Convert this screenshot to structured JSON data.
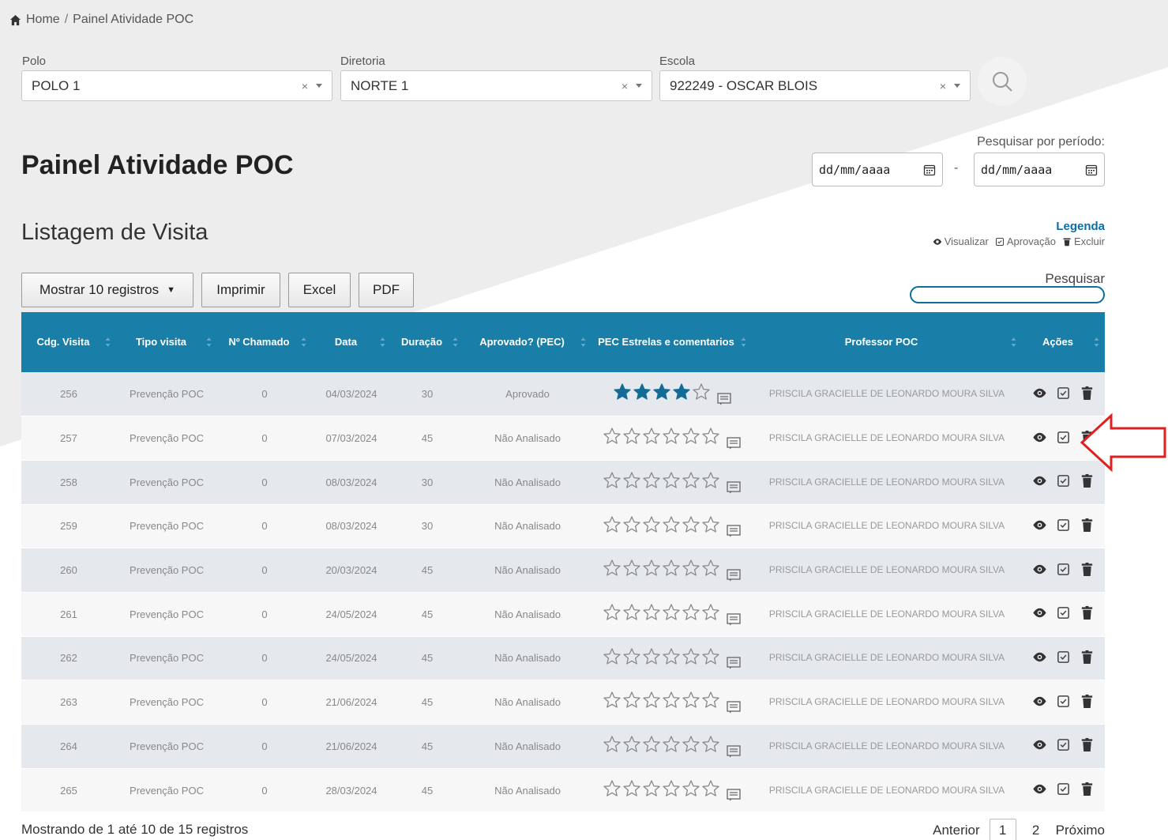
{
  "breadcrumb": {
    "home": "Home",
    "current": "Painel Atividade POC"
  },
  "filters": {
    "polo": {
      "label": "Polo",
      "value": "POLO 1"
    },
    "diretoria": {
      "label": "Diretoria",
      "value": "NORTE 1"
    },
    "escola": {
      "label": "Escola",
      "value": "922249 - OSCAR BLOIS"
    },
    "clear_symbol": "×"
  },
  "page_title": "Painel Atividade POC",
  "period": {
    "label": "Pesquisar por período:",
    "start_placeholder": "dd/mm/aaaa",
    "end_placeholder": "dd/mm/aaaa",
    "separator": "-"
  },
  "section_title": "Listagem de Visita",
  "legend": {
    "title": "Legenda",
    "view": "Visualizar",
    "approve": "Aprovação",
    "delete": "Excluir"
  },
  "toolbar": {
    "show_records": "Mostrar 10 registros",
    "print": "Imprimir",
    "excel": "Excel",
    "pdf": "PDF",
    "search_label": "Pesquisar"
  },
  "table": {
    "headers": {
      "code": "Cdg. Visita",
      "type": "Tipo visita",
      "ticket": "Nº Chamado",
      "date": "Data",
      "duration": "Duração",
      "approved": "Aprovado? (PEC)",
      "pec": "PEC Estrelas e comentarios",
      "teacher": "Professor POC",
      "actions": "Ações"
    },
    "rows": [
      {
        "code": "256",
        "type": "Prevenção POC",
        "ticket": "0",
        "date": "04/03/2024",
        "duration": "30",
        "approved": "Aprovado",
        "stars": 4,
        "teacher": "PRISCILA GRACIELLE DE LEONARDO MOURA SILVA"
      },
      {
        "code": "257",
        "type": "Prevenção POC",
        "ticket": "0",
        "date": "07/03/2024",
        "duration": "45",
        "approved": "Não Analisado",
        "stars": 0,
        "teacher": "PRISCILA GRACIELLE DE LEONARDO MOURA SILVA"
      },
      {
        "code": "258",
        "type": "Prevenção POC",
        "ticket": "0",
        "date": "08/03/2024",
        "duration": "30",
        "approved": "Não Analisado",
        "stars": 0,
        "teacher": "PRISCILA GRACIELLE DE LEONARDO MOURA SILVA"
      },
      {
        "code": "259",
        "type": "Prevenção POC",
        "ticket": "0",
        "date": "08/03/2024",
        "duration": "30",
        "approved": "Não Analisado",
        "stars": 0,
        "teacher": "PRISCILA GRACIELLE DE LEONARDO MOURA SILVA"
      },
      {
        "code": "260",
        "type": "Prevenção POC",
        "ticket": "0",
        "date": "20/03/2024",
        "duration": "45",
        "approved": "Não Analisado",
        "stars": 0,
        "teacher": "PRISCILA GRACIELLE DE LEONARDO MOURA SILVA"
      },
      {
        "code": "261",
        "type": "Prevenção POC",
        "ticket": "0",
        "date": "24/05/2024",
        "duration": "45",
        "approved": "Não Analisado",
        "stars": 0,
        "teacher": "PRISCILA GRACIELLE DE LEONARDO MOURA SILVA"
      },
      {
        "code": "262",
        "type": "Prevenção POC",
        "ticket": "0",
        "date": "24/05/2024",
        "duration": "45",
        "approved": "Não Analisado",
        "stars": 0,
        "teacher": "PRISCILA GRACIELLE DE LEONARDO MOURA SILVA"
      },
      {
        "code": "263",
        "type": "Prevenção POC",
        "ticket": "0",
        "date": "21/06/2024",
        "duration": "45",
        "approved": "Não Analisado",
        "stars": 0,
        "teacher": "PRISCILA GRACIELLE DE LEONARDO MOURA SILVA"
      },
      {
        "code": "264",
        "type": "Prevenção POC",
        "ticket": "0",
        "date": "21/06/2024",
        "duration": "45",
        "approved": "Não Analisado",
        "stars": 0,
        "teacher": "PRISCILA GRACIELLE DE LEONARDO MOURA SILVA"
      },
      {
        "code": "265",
        "type": "Prevenção POC",
        "ticket": "0",
        "date": "28/03/2024",
        "duration": "45",
        "approved": "Não Analisado",
        "stars": 0,
        "teacher": "PRISCILA GRACIELLE DE LEONARDO MOURA SILVA"
      }
    ]
  },
  "footer": {
    "info": "Mostrando de 1 até 10 de 15 registros",
    "prev": "Anterior",
    "page1": "1",
    "page2": "2",
    "next": "Próximo"
  },
  "colors": {
    "header_bg": "#1a7fa8",
    "star": "#136b96",
    "arrow": "#e02020"
  }
}
